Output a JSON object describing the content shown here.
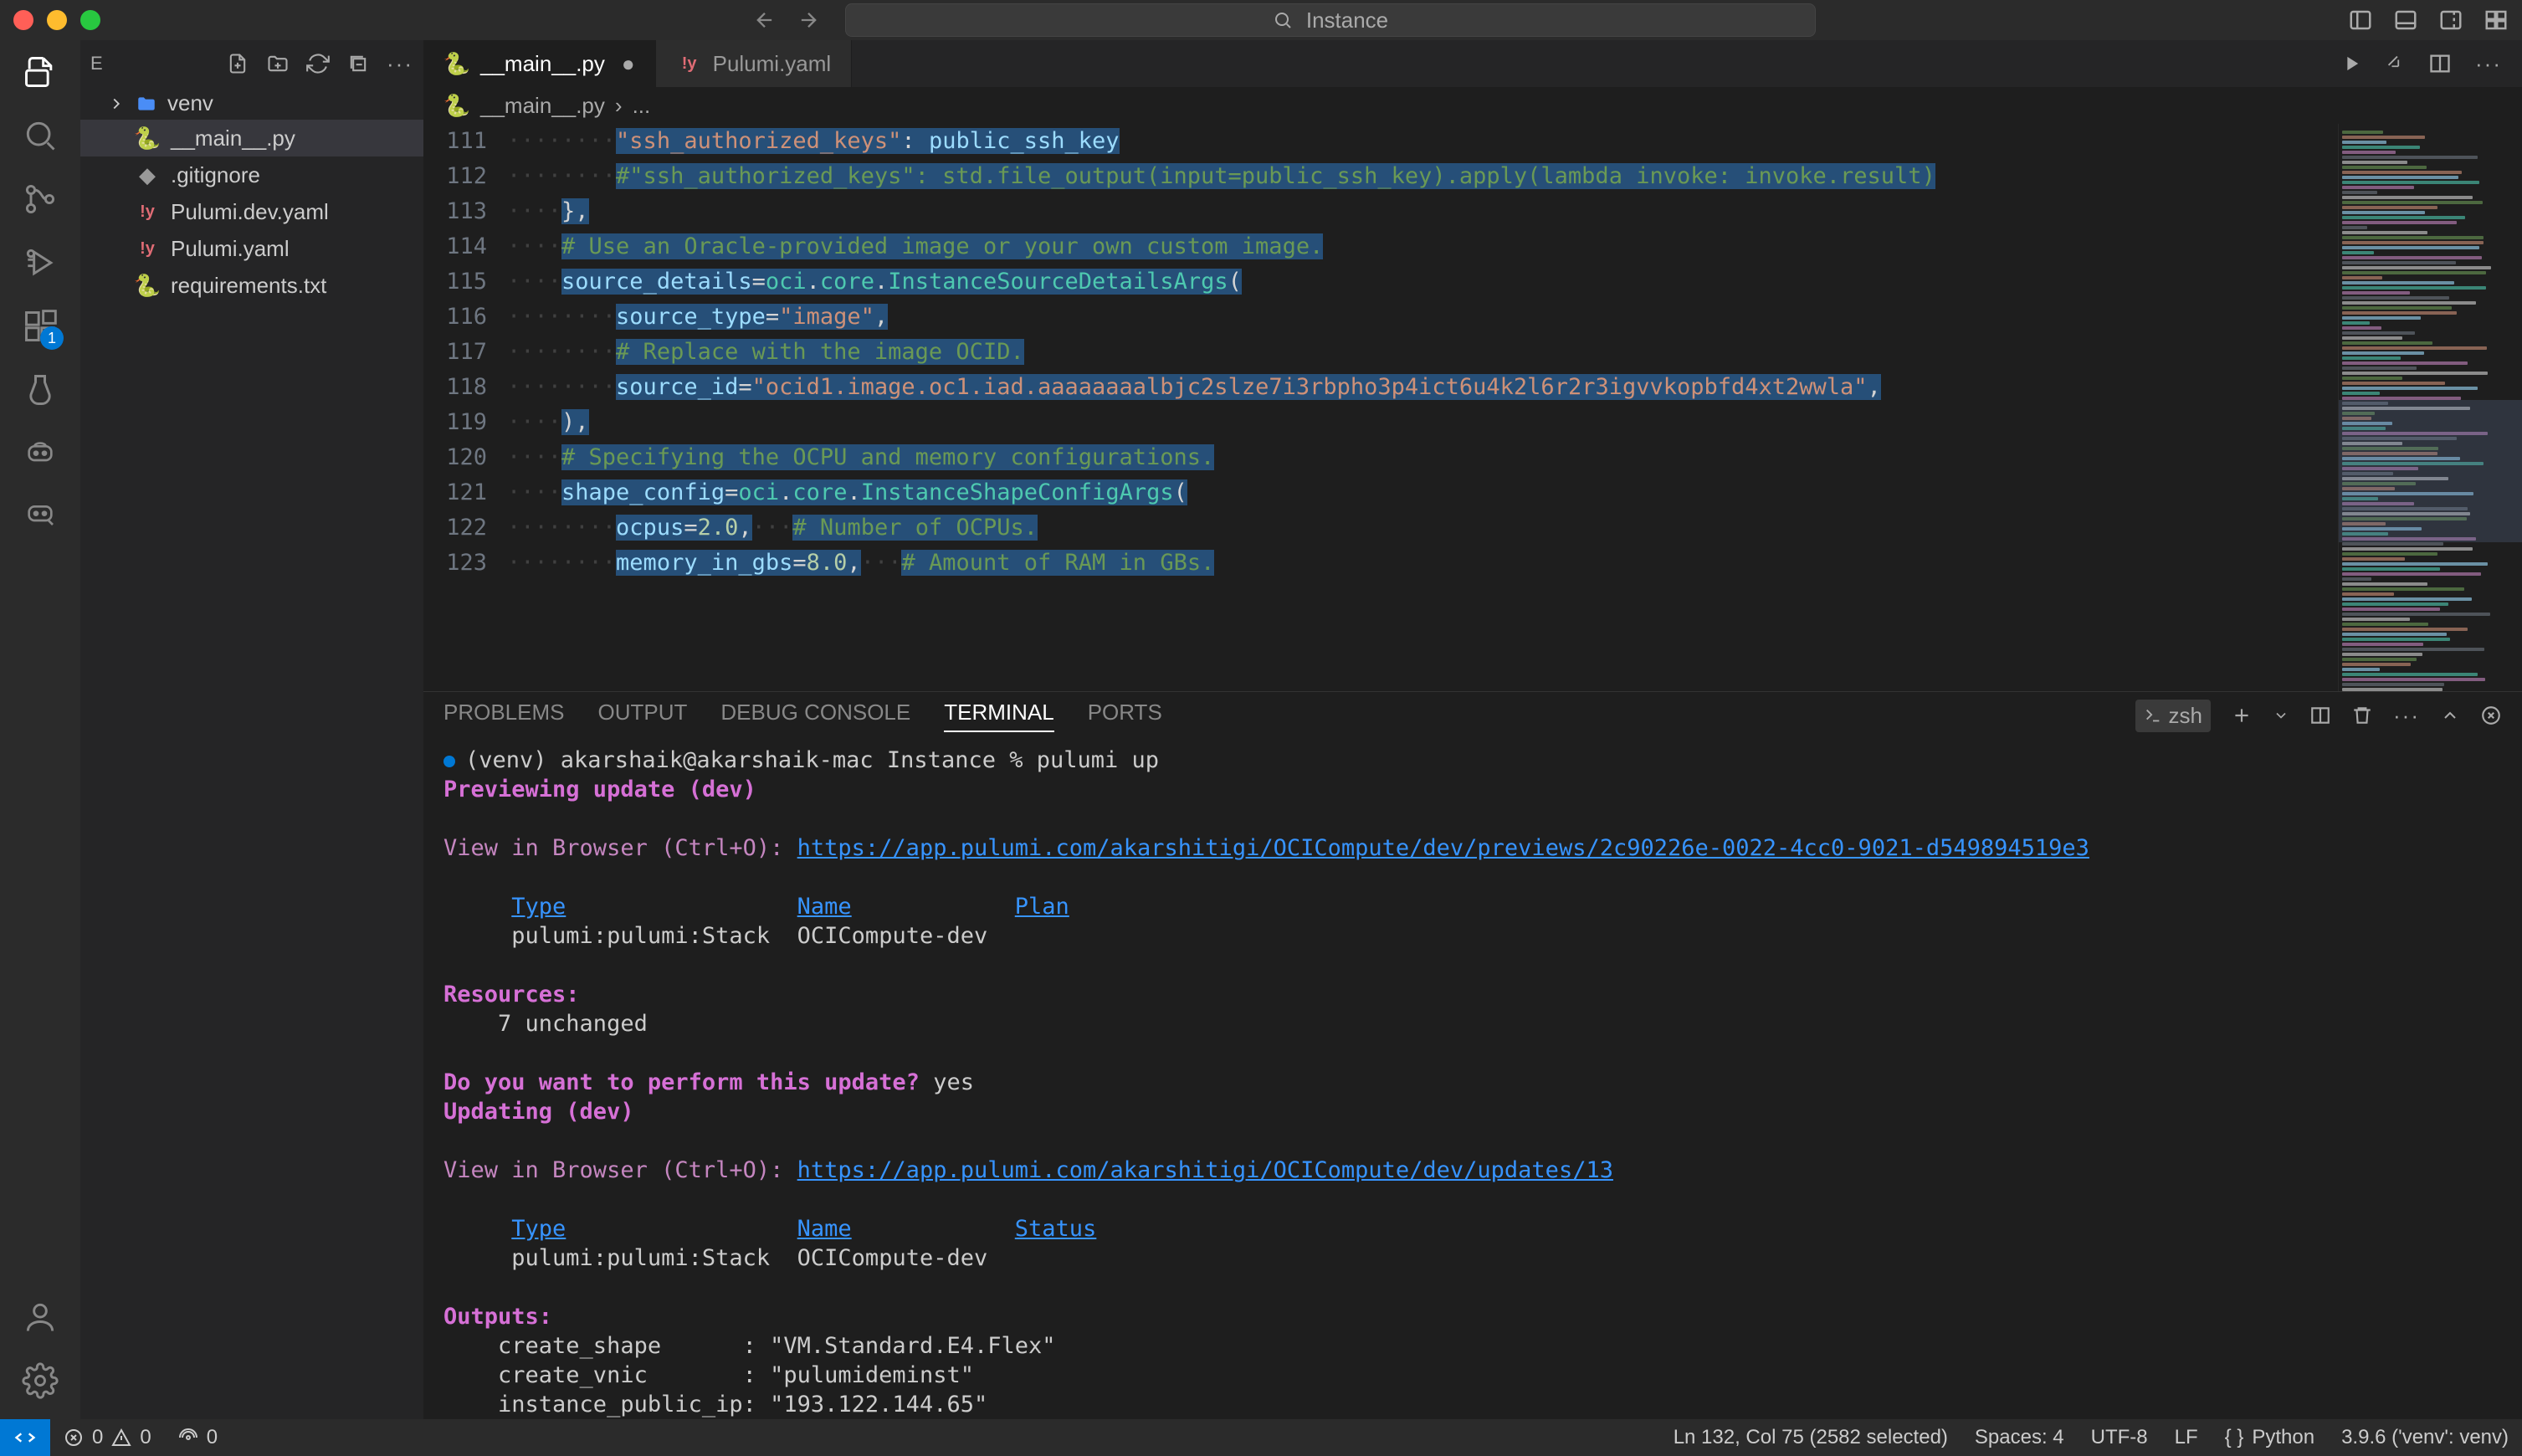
{
  "titlebar": {
    "search_text": "Instance"
  },
  "sidebar": {
    "explorer_label": "E",
    "folder": "venv",
    "files": [
      {
        "name": "__main__.py",
        "icon": "python",
        "active": true
      },
      {
        "name": ".gitignore",
        "icon": "git",
        "active": false
      },
      {
        "name": "Pulumi.dev.yaml",
        "icon": "yaml",
        "active": false
      },
      {
        "name": "Pulumi.yaml",
        "icon": "yaml",
        "active": false
      },
      {
        "name": "requirements.txt",
        "icon": "python",
        "active": false
      }
    ]
  },
  "tabs": [
    {
      "name": "__main__.py",
      "icon": "python",
      "active": true,
      "dirty": true
    },
    {
      "name": "Pulumi.yaml",
      "icon": "yaml",
      "active": false,
      "dirty": false
    }
  ],
  "breadcrumb": {
    "file": "__main__.py",
    "rest": "..."
  },
  "editor": {
    "first_line": 111,
    "lines": [
      {
        "n": 111,
        "html": "<span class='ws'>········</span><span class='sel'><span class='str'>\"ssh_authorized_keys\"</span>: <span class='prop'>public_ssh_key</span></span>"
      },
      {
        "n": 112,
        "html": "<span class='ws'>········</span><span class='sel'><span class='com'>#\"ssh_authorized_keys\": std.file_output(input=public_ssh_key).apply(lambda invoke: invoke.result)</span></span>"
      },
      {
        "n": 113,
        "html": "<span class='ws'>····</span><span class='sel'>},</span>"
      },
      {
        "n": 114,
        "html": "<span class='ws'>····</span><span class='sel'><span class='com'># Use an Oracle-provided image or your own custom image.</span></span>"
      },
      {
        "n": 115,
        "html": "<span class='ws'>····</span><span class='sel'><span class='prop'>source_details</span>=<span class='mod'>oci</span>.<span class='mod'>core</span>.<span class='fn'>InstanceSourceDetailsArgs</span>(</span>"
      },
      {
        "n": 116,
        "html": "<span class='ws'>········</span><span class='sel'><span class='prop'>source_type</span>=<span class='str'>\"image\"</span>,</span>"
      },
      {
        "n": 117,
        "html": "<span class='ws'>········</span><span class='sel'><span class='com'># Replace with the image OCID.</span></span>"
      },
      {
        "n": 118,
        "html": "<span class='ws'>········</span><span class='sel'><span class='prop'>source_id</span>=<span class='str'>\"ocid1.image.oc1.iad.aaaaaaaalbjc2slze7i3rbpho3p4ict6u4k2l6r2r3igvvkopbfd4xt2wwla\"</span>,</span>"
      },
      {
        "n": 119,
        "html": "<span class='ws'>····</span><span class='sel'>),</span>"
      },
      {
        "n": 120,
        "html": "<span class='ws'>····</span><span class='sel'><span class='com'># Specifying the OCPU and memory configurations.</span></span>"
      },
      {
        "n": 121,
        "html": "<span class='ws'>····</span><span class='sel'><span class='prop'>shape_config</span>=<span class='mod'>oci</span>.<span class='mod'>core</span>.<span class='fn'>InstanceShapeConfigArgs</span>(</span>"
      },
      {
        "n": 122,
        "html": "<span class='ws'>········</span><span class='sel'><span class='prop'>ocpus</span>=<span class='num'>2.0</span>,</span><span class='ws'>···</span><span class='sel'><span class='com'># Number of OCPUs.</span></span>"
      },
      {
        "n": 123,
        "html": "<span class='ws'>········</span><span class='sel'><span class='prop'>memory_in_gbs</span>=<span class='num'>8.0</span>,</span><span class='ws'>···</span><span class='sel'><span class='com'># Amount of RAM in GBs.</span></span>"
      }
    ]
  },
  "panel": {
    "tabs": [
      "PROBLEMS",
      "OUTPUT",
      "DEBUG CONSOLE",
      "TERMINAL",
      "PORTS"
    ],
    "active_tab": "TERMINAL",
    "shell": "zsh"
  },
  "terminal": {
    "prompt": "(venv) akarshaik@akarshaik-mac Instance % ",
    "command": "pulumi up",
    "previewing": "Previewing update (dev)",
    "view_label": "View in Browser (Ctrl+O): ",
    "preview_url": "https://app.pulumi.com/akarshitigi/OCICompute/dev/previews/2c90226e-0022-4cc0-9021-d549894519e3",
    "header_type": "Type",
    "header_name": "Name",
    "header_plan": "Plan",
    "stack_type": "pulumi:pulumi:Stack",
    "stack_name": "OCICompute-dev",
    "resources_label": "Resources:",
    "resources_line": "    7 unchanged",
    "confirm_prompt": "Do you want to perform this update?",
    "confirm_answer": " yes",
    "updating": "Updating (dev)",
    "update_url": "https://app.pulumi.com/akarshitigi/OCICompute/dev/updates/13",
    "header_status": "Status",
    "outputs_label": "Outputs:",
    "out1": "    create_shape      : \"VM.Standard.E4.Flex\"",
    "out2": "    create_vnic       : \"pulumideminst\"",
    "out3": "    instance_public_ip: \"193.122.144.65\""
  },
  "status": {
    "errors": "0",
    "warnings": "0",
    "ports": "0",
    "cursor": "Ln 132, Col 75 (2582 selected)",
    "spaces": "Spaces: 4",
    "encoding": "UTF-8",
    "eol": "LF",
    "lang": "Python",
    "interpreter": "3.9.6 ('venv': venv)"
  },
  "activity_badge": "1"
}
